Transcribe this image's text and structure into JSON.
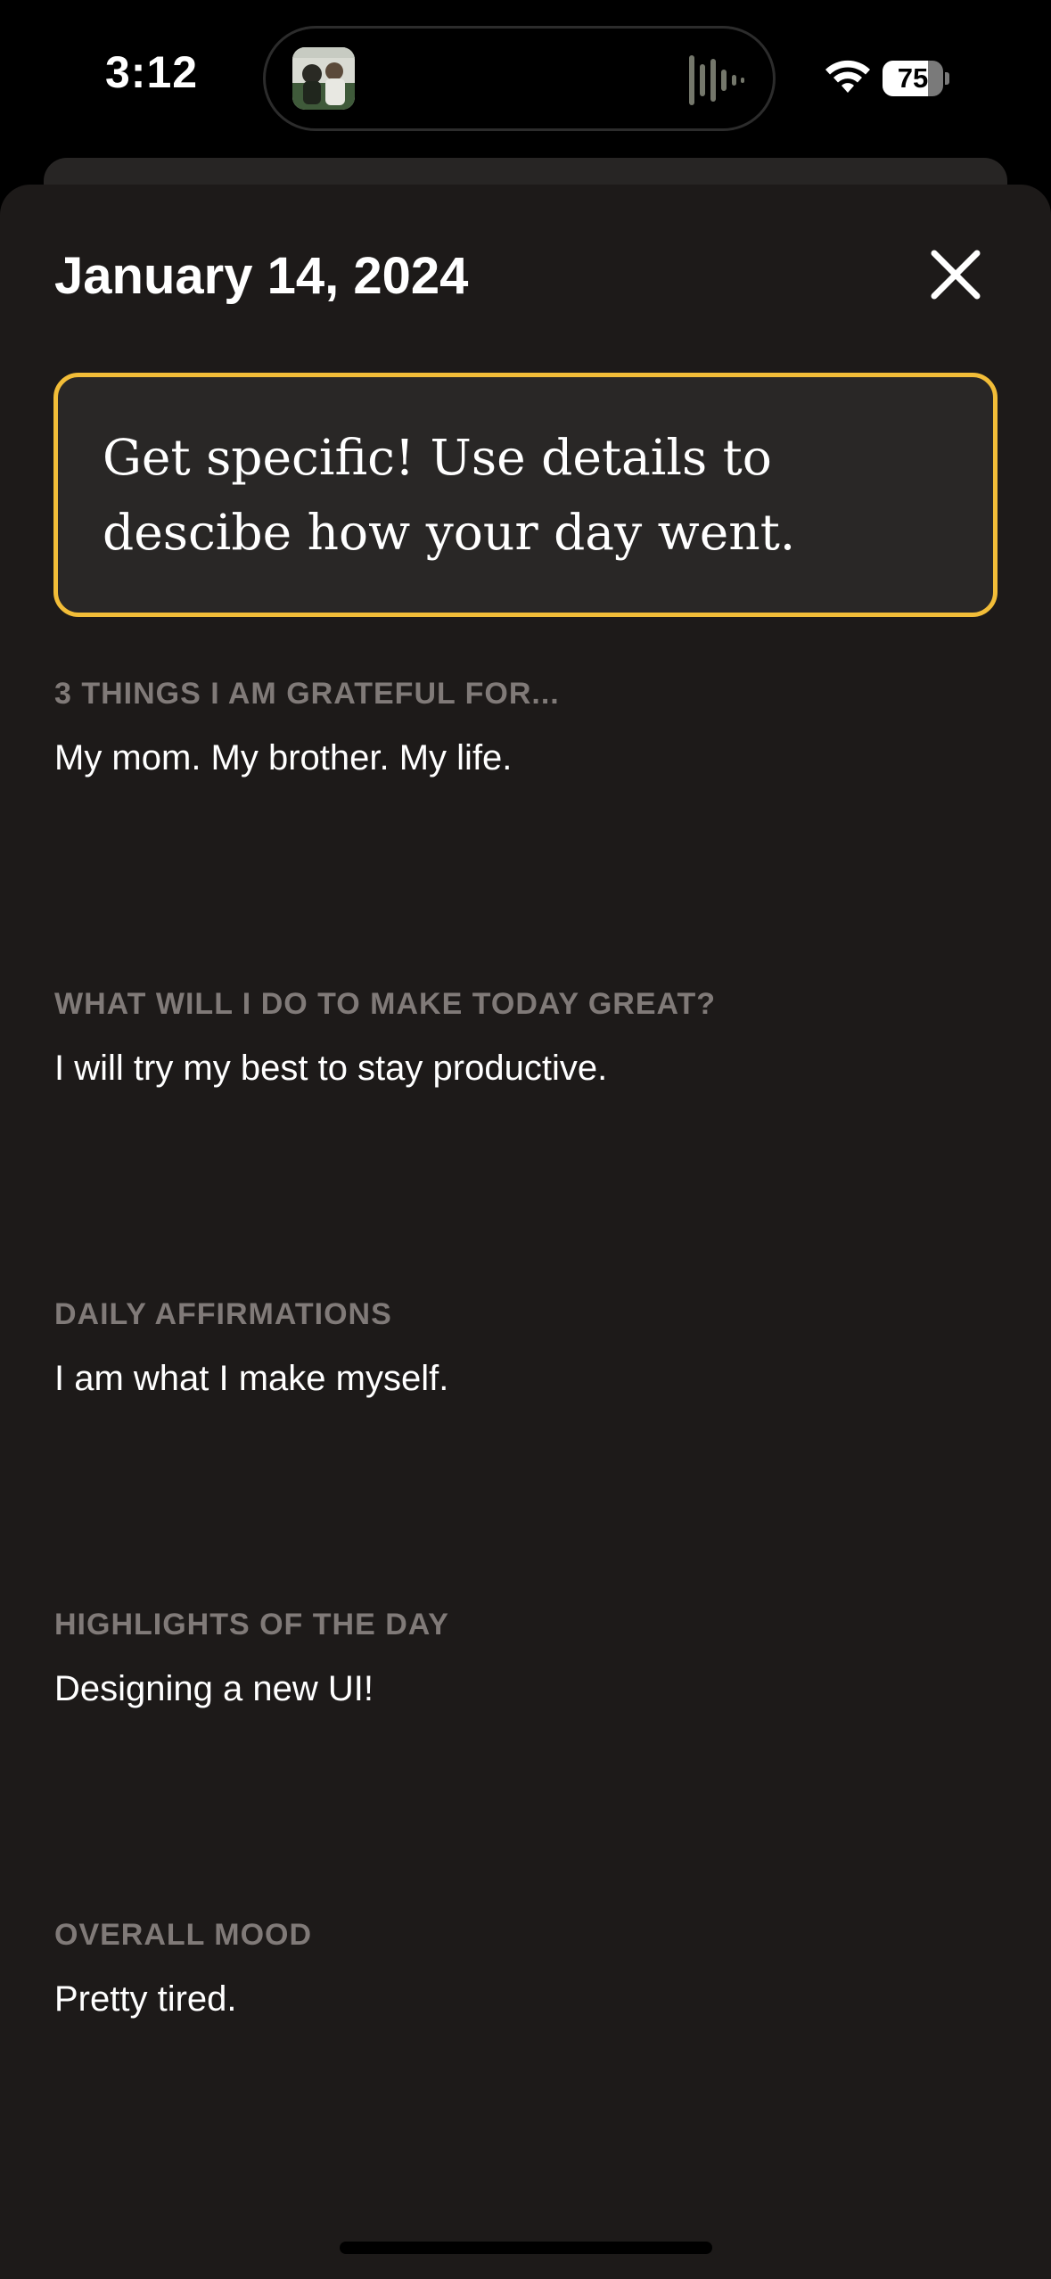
{
  "status_bar": {
    "time": "3:12",
    "battery_level": "75",
    "battery_fraction": 0.75
  },
  "icons": {
    "wifi": "wifi-icon",
    "close": "close-icon",
    "waveform": "waveform-icon",
    "album_art": "album-art"
  },
  "colors": {
    "accent": "#f2bd38",
    "background": "#1d1a19",
    "card": "#292726",
    "heading": "#807a78",
    "text": "#ffffff"
  },
  "entry": {
    "date": "January 14, 2024",
    "prompt": "Get specific! Use details to descibe how your day went.",
    "sections": [
      {
        "heading": "3 THINGS I AM GRATEFUL FOR...",
        "answer": "My mom. My brother. My life."
      },
      {
        "heading": "WHAT WILL I DO TO MAKE TODAY GREAT?",
        "answer": "I will try my best to stay productive."
      },
      {
        "heading": "DAILY AFFIRMATIONS",
        "answer": "I am what I make myself."
      },
      {
        "heading": "HIGHLIGHTS OF THE DAY",
        "answer": "Designing a new UI!"
      },
      {
        "heading": "OVERALL MOOD",
        "answer": "Pretty tired."
      }
    ]
  }
}
